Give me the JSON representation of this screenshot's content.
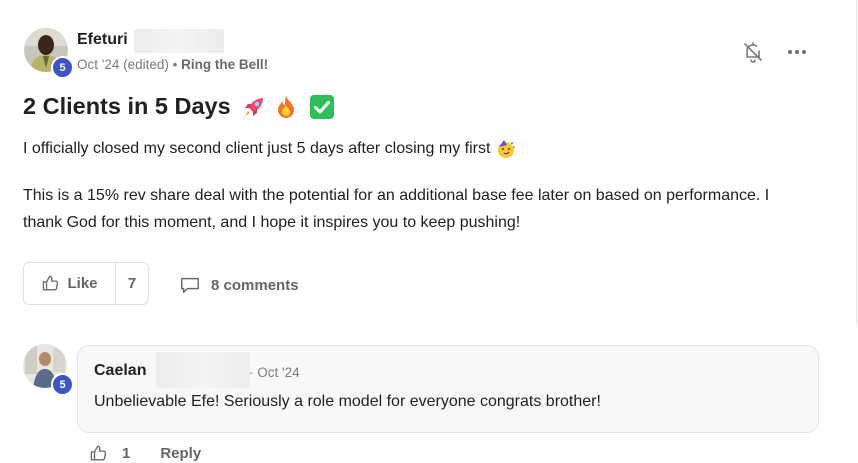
{
  "post": {
    "author_name": "Efeturi",
    "author_level": "5",
    "date": "Oct '24 (edited)",
    "separator": "•",
    "category": "Ring the Bell!",
    "title": "2 Clients in 5 Days",
    "title_emojis": [
      "rocket-emoji",
      "fire-emoji",
      "check-mark-emoji"
    ],
    "paragraph1": "I officially closed my second client just 5 days after closing my first",
    "paragraph1_emoji": "partying-face-emoji",
    "paragraph2": "This is a 15% rev share deal with the potential for an additional base fee later on based on performance. I thank God for this moment, and I hope it inspires you to keep pushing!",
    "like_label": "Like",
    "like_count": "7",
    "comments_label": "8 comments"
  },
  "comment": {
    "author_name": "Caelan",
    "author_level": "5",
    "date": "· Oct '24",
    "text": "Unbelievable Efe! Seriously a role model for everyone congrats brother!",
    "like_count": "1",
    "reply_label": "Reply"
  },
  "icons": {
    "bell": "bell-off-icon",
    "more": "more-horizontal-icon",
    "like": "thumbs-up-icon",
    "comments": "comment-icon"
  },
  "colors": {
    "level_badge": "#3d55c4",
    "text_primary": "#202124",
    "text_muted": "#7a7a7a"
  }
}
